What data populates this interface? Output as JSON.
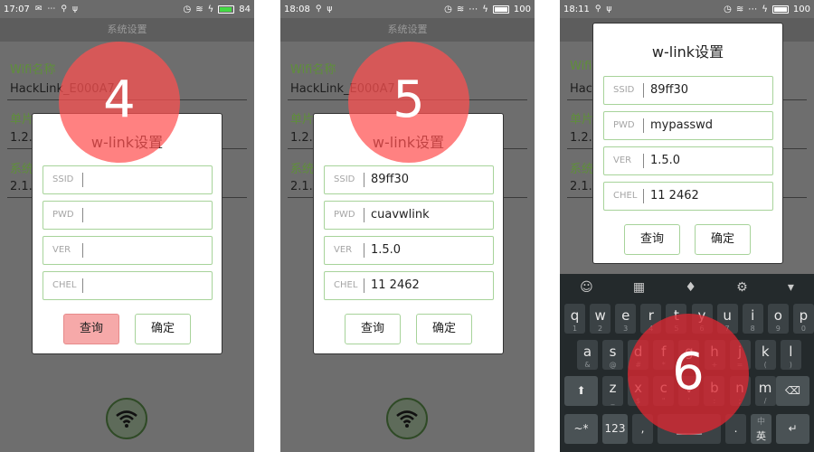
{
  "phones": [
    {
      "status": {
        "time": "17:07",
        "battery": "84"
      },
      "appbar_title": "系统设置",
      "fields": [
        {
          "label": "Wifi名称",
          "value": "HackLink_E000A7"
        },
        {
          "label": "单片",
          "value": "1.2."
        },
        {
          "label": "系统",
          "value": "2.1."
        }
      ],
      "dialog": {
        "title": "w-link设置",
        "inputs": [
          {
            "label": "SSID",
            "value": ""
          },
          {
            "label": "PWD",
            "value": ""
          },
          {
            "label": "VER",
            "value": ""
          },
          {
            "label": "CHEL",
            "value": ""
          }
        ],
        "query_label": "查询",
        "confirm_label": "确定"
      },
      "step_marker": "4"
    },
    {
      "status": {
        "time": "18:08",
        "battery": "100"
      },
      "appbar_title": "系统设置",
      "fields": [
        {
          "label": "Wifi名称",
          "value": "HackLink_E000A7"
        },
        {
          "label": "单片",
          "value": "1.2."
        },
        {
          "label": "系统",
          "value": "2.1."
        }
      ],
      "dialog": {
        "title": "w-link设置",
        "inputs": [
          {
            "label": "SSID",
            "value": "89ff30"
          },
          {
            "label": "PWD",
            "value": "cuavwlink"
          },
          {
            "label": "VER",
            "value": "1.5.0"
          },
          {
            "label": "CHEL",
            "value": "11 2462"
          }
        ],
        "query_label": "查询",
        "confirm_label": "确定"
      },
      "step_marker": "5"
    },
    {
      "status": {
        "time": "18:11",
        "battery": "100"
      },
      "fields": [
        {
          "label": "Wifi",
          "value": "Hac"
        },
        {
          "label": "单片",
          "value": "1.2."
        },
        {
          "label": "系统",
          "value": "2.1."
        }
      ],
      "dialog": {
        "title": "w-link设置",
        "inputs": [
          {
            "label": "SSID",
            "value": "89ff30"
          },
          {
            "label": "PWD",
            "value": "mypasswd"
          },
          {
            "label": "VER",
            "value": "1.5.0"
          },
          {
            "label": "CHEL",
            "value": "11 2462"
          }
        ],
        "query_label": "查询",
        "confirm_label": "确定"
      },
      "step_marker": "6",
      "keyboard": {
        "row1": [
          {
            "k": "q",
            "s": "1"
          },
          {
            "k": "w",
            "s": "2"
          },
          {
            "k": "e",
            "s": "3"
          },
          {
            "k": "r",
            "s": "4"
          },
          {
            "k": "t",
            "s": "5"
          },
          {
            "k": "y",
            "s": "6"
          },
          {
            "k": "u",
            "s": "7"
          },
          {
            "k": "i",
            "s": "8"
          },
          {
            "k": "o",
            "s": "9"
          },
          {
            "k": "p",
            "s": "0"
          }
        ],
        "row2": [
          {
            "k": "a",
            "s": "&"
          },
          {
            "k": "s",
            "s": "@"
          },
          {
            "k": "d",
            "s": "#"
          },
          {
            "k": "f",
            "s": "*"
          },
          {
            "k": "g",
            "s": "-"
          },
          {
            "k": "h",
            "s": "+"
          },
          {
            "k": "j",
            "s": "="
          },
          {
            "k": "k",
            "s": "("
          },
          {
            "k": "l",
            "s": ")"
          }
        ],
        "row3": [
          {
            "k": "z",
            "s": "_"
          },
          {
            "k": "x",
            "s": "$"
          },
          {
            "k": "c",
            "s": "\""
          },
          {
            "k": "v",
            "s": "'"
          },
          {
            "k": "b",
            "s": ":"
          },
          {
            "k": "n",
            "s": ";"
          },
          {
            "k": "m",
            "s": "/"
          }
        ],
        "sym_label": "~*",
        "num_label": "123",
        "lang_top": "中",
        "lang_bottom": "英"
      }
    }
  ]
}
